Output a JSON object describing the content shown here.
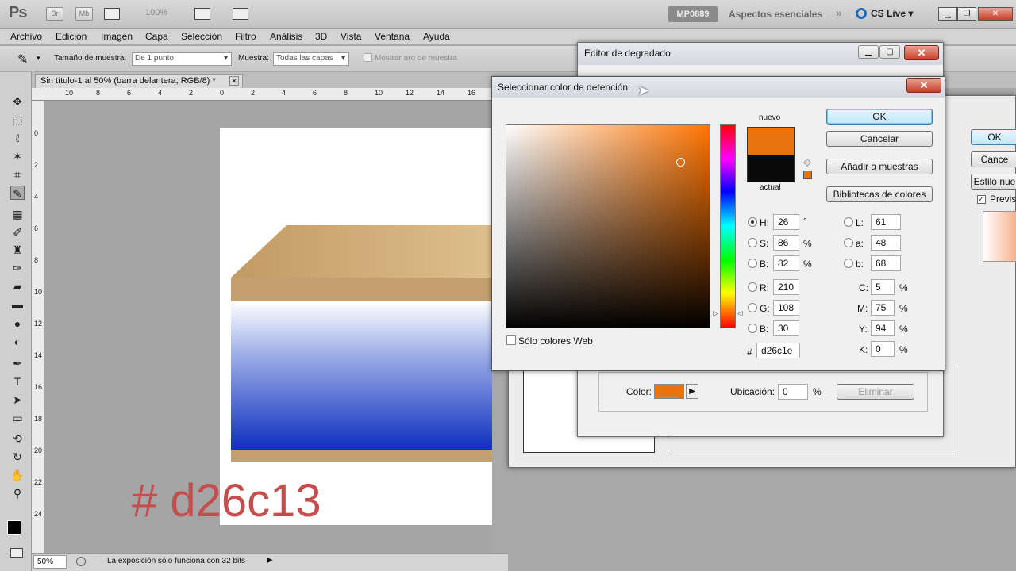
{
  "app": {
    "logo": "Ps",
    "bridge_btn": "Br",
    "minibridge_btn": "Mb",
    "zoom": "100%",
    "workspace_user": "MP0889",
    "workspace": "Aspectos esenciales",
    "cslive": "CS Live"
  },
  "menu": [
    "Archivo",
    "Edición",
    "Imagen",
    "Capa",
    "Selección",
    "Filtro",
    "Análisis",
    "3D",
    "Vista",
    "Ventana",
    "Ayuda"
  ],
  "options": {
    "sample_size_label": "Tamaño de muestra:",
    "sample_size_value": "De 1 punto",
    "sample_label": "Muestra:",
    "sample_value": "Todas las capas",
    "ring_label": "Mostrar aro de muestra"
  },
  "document": {
    "tab_title": "Sin título-1 al 50% (barra delantera, RGB/8) *",
    "zoom": "50%",
    "status": "La exposición sólo funciona con 32 bits",
    "overlay_text": "# d26c13",
    "ruler_h": [
      "10",
      "8",
      "6",
      "4",
      "2",
      "0",
      "2",
      "4",
      "6",
      "8",
      "10",
      "12",
      "14",
      "16"
    ],
    "ruler_v": [
      "0",
      "2",
      "4",
      "6",
      "8",
      "10",
      "12",
      "14",
      "16",
      "18",
      "20",
      "22",
      "24"
    ]
  },
  "gradient_editor": {
    "title": "Editor de degradado",
    "color_label": "Color:",
    "location_label": "Ubicación:",
    "location_value": "0",
    "location_unit": "%",
    "delete_btn": "Eliminar",
    "color_hex": "#e8740f"
  },
  "back_dialog": {
    "ok": "OK",
    "cancel": "Cance",
    "style": "Estilo nue",
    "preview": "Previsu"
  },
  "picker": {
    "title": "Seleccionar color de detención:",
    "ok": "OK",
    "cancel": "Cancelar",
    "add_swatches": "Añadir a muestras",
    "libraries": "Bibliotecas de colores",
    "new_label": "nuevo",
    "current_label": "actual",
    "new_color": "#e8740f",
    "current_color": "#0a0a0a",
    "web_only": "Sólo colores Web",
    "hsb": [
      {
        "k": "H:",
        "v": "26",
        "u": "°",
        "on": true
      },
      {
        "k": "S:",
        "v": "86",
        "u": "%",
        "on": false
      },
      {
        "k": "B:",
        "v": "82",
        "u": "%",
        "on": false
      }
    ],
    "rgb": [
      {
        "k": "R:",
        "v": "210"
      },
      {
        "k": "G:",
        "v": "108"
      },
      {
        "k": "B:",
        "v": "30"
      }
    ],
    "lab": [
      {
        "k": "L:",
        "v": "61"
      },
      {
        "k": "a:",
        "v": "48"
      },
      {
        "k": "b:",
        "v": "68"
      }
    ],
    "cmyk": [
      {
        "k": "C:",
        "v": "5",
        "u": "%"
      },
      {
        "k": "M:",
        "v": "75",
        "u": "%"
      },
      {
        "k": "Y:",
        "v": "94",
        "u": "%"
      },
      {
        "k": "K:",
        "v": "0",
        "u": "%"
      }
    ],
    "hex_label": "#",
    "hex": "d26c1e",
    "hue_color": "#ff7400"
  }
}
